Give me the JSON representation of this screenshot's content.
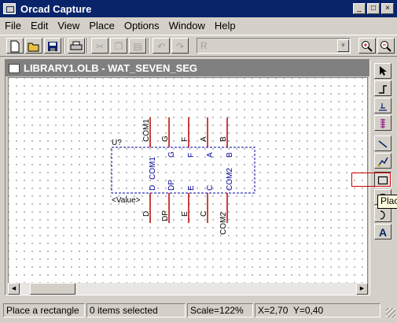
{
  "app": {
    "title": "Orcad Capture"
  },
  "menu": [
    "File",
    "Edit",
    "View",
    "Place",
    "Options",
    "Window",
    "Help"
  ],
  "toolbar": {
    "part_combo_value": "R"
  },
  "document": {
    "title": "LIBRARY1.OLB - WAT_SEVEN_SEG",
    "part": {
      "reference": "U?",
      "value": "<Value>",
      "top_pins": [
        {
          "number": "COM1",
          "name": "COM1"
        },
        {
          "number": "G",
          "name": "G"
        },
        {
          "number": "F",
          "name": "F"
        },
        {
          "number": "A",
          "name": "A"
        },
        {
          "number": "B",
          "name": "B"
        }
      ],
      "bottom_pins": [
        {
          "number": "D",
          "name": "D"
        },
        {
          "number": "DP",
          "name": "DP"
        },
        {
          "number": "E",
          "name": "E"
        },
        {
          "number": "C",
          "name": "C"
        },
        {
          "number": "COM2",
          "name": "COM2"
        }
      ]
    }
  },
  "palette": {
    "tooltip": "Plac"
  },
  "status": {
    "message": "Place a rectangle",
    "selection": "0 items selected",
    "scale": "Scale=122%",
    "coords": "X=2,70  Y=0,40"
  },
  "colors": {
    "pin": "#c00000",
    "part_body": "#0000a0",
    "pin_name": "#0000a0",
    "title_active": "#0a246a",
    "title_inactive": "#808080"
  }
}
